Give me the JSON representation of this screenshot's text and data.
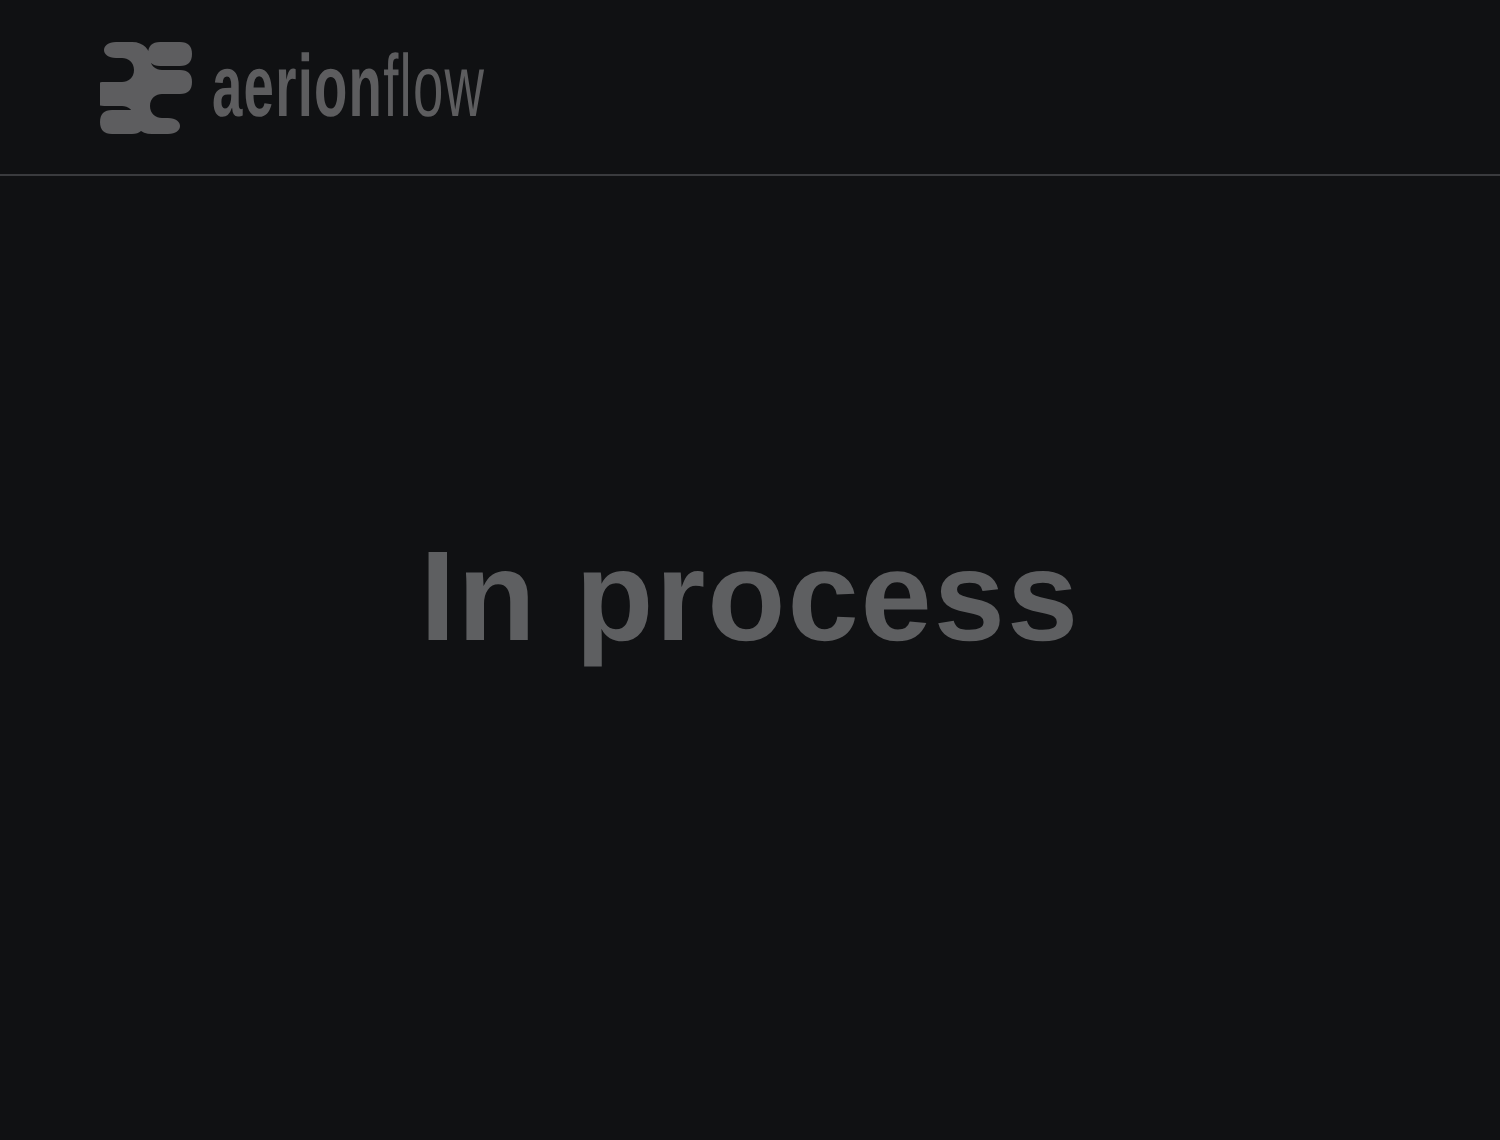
{
  "header": {
    "logo_text": "**aerion**flow"
  },
  "message": "In process"
}
